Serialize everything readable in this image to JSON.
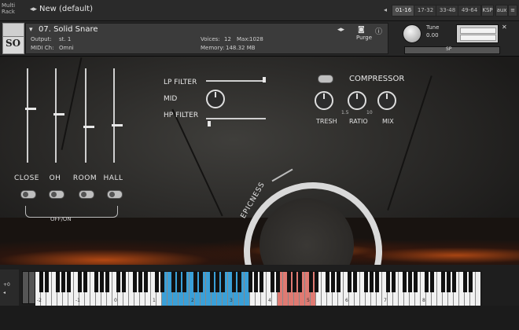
{
  "topbar": {
    "multi_rack": [
      "Multi",
      "Rack"
    ],
    "rack_name": "New (default)",
    "tabs": [
      "01-16",
      "17-32",
      "33-48",
      "49-64"
    ],
    "kspb": "KSP",
    "aux": "aux"
  },
  "instrument": {
    "name": "07. Solid Snare",
    "output_label": "Output:",
    "output_value": "st. 1",
    "midi_label": "MIDI Ch:",
    "midi_value": "Omni",
    "voices_label": "Voices:",
    "voices_value": "12",
    "max_label": "Max:",
    "max_value": "1028",
    "memory_label": "Memory:",
    "memory_value": "148.32 MB",
    "purge": "Purge",
    "tune_label": "Tune",
    "tune_value": "0.00",
    "pan_label": "SP"
  },
  "mixer": {
    "faders": [
      {
        "label": "CLOSE",
        "level": 0.58
      },
      {
        "label": "OH",
        "level": 0.52
      },
      {
        "label": "ROOM",
        "level": 0.38
      },
      {
        "label": "HALL",
        "level": 0.4
      }
    ],
    "offon": "OFF/ON"
  },
  "filters": {
    "lp": "LP FILTER",
    "mid": "MID",
    "hp": "HP FILTER"
  },
  "compressor": {
    "title": "COMPRESSOR",
    "knobs": [
      "TRESH",
      "RATIO",
      "MIX"
    ],
    "ratio_min": "1.5",
    "ratio_max": "10"
  },
  "epicness": {
    "label": "EPICNESS"
  },
  "keyboard": {
    "octaves": [
      "-2",
      "-1",
      "0",
      "1",
      "2",
      "3",
      "4",
      "5",
      "6",
      "7",
      "8"
    ],
    "side_labels": [
      "+0"
    ],
    "colors": {
      "blue": "#3aa0d8",
      "red": "#e07a72"
    }
  }
}
